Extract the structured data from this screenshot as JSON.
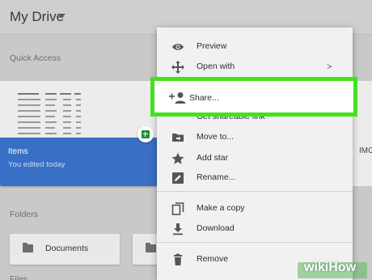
{
  "header": {
    "title": "My Drive"
  },
  "quick_access": {
    "label": "Quick Access",
    "card": {
      "name": "Items",
      "subtitle": "You edited today"
    },
    "partial_card_label": "IMG"
  },
  "folders": {
    "label": "Folders",
    "items": [
      {
        "name": "Documents"
      }
    ],
    "files_label_partial": "Files"
  },
  "context_menu": {
    "items": [
      {
        "label": "Preview",
        "icon": "eye-icon"
      },
      {
        "label": "Open with",
        "icon": "move-arrows-icon",
        "submenu_indicator": ">"
      },
      {
        "label": "Share...",
        "icon": "add-person-icon",
        "highlighted": true
      },
      {
        "label": "Get shareable link",
        "icon": "link-icon"
      },
      {
        "label": "Move to...",
        "icon": "folder-move-icon"
      },
      {
        "label": "Add star",
        "icon": "star-icon"
      },
      {
        "label": "Rename...",
        "icon": "pencil-icon"
      },
      {
        "label": "Make a copy",
        "icon": "copy-icon"
      },
      {
        "label": "Download",
        "icon": "download-icon"
      },
      {
        "label": "Remove",
        "icon": "trash-icon"
      }
    ]
  },
  "colors": {
    "highlight_border": "#41e31d",
    "card_footer": "#3a6fc6",
    "sheets_green": "#1e8e3e"
  },
  "watermark": {
    "text": "wikiHow"
  }
}
